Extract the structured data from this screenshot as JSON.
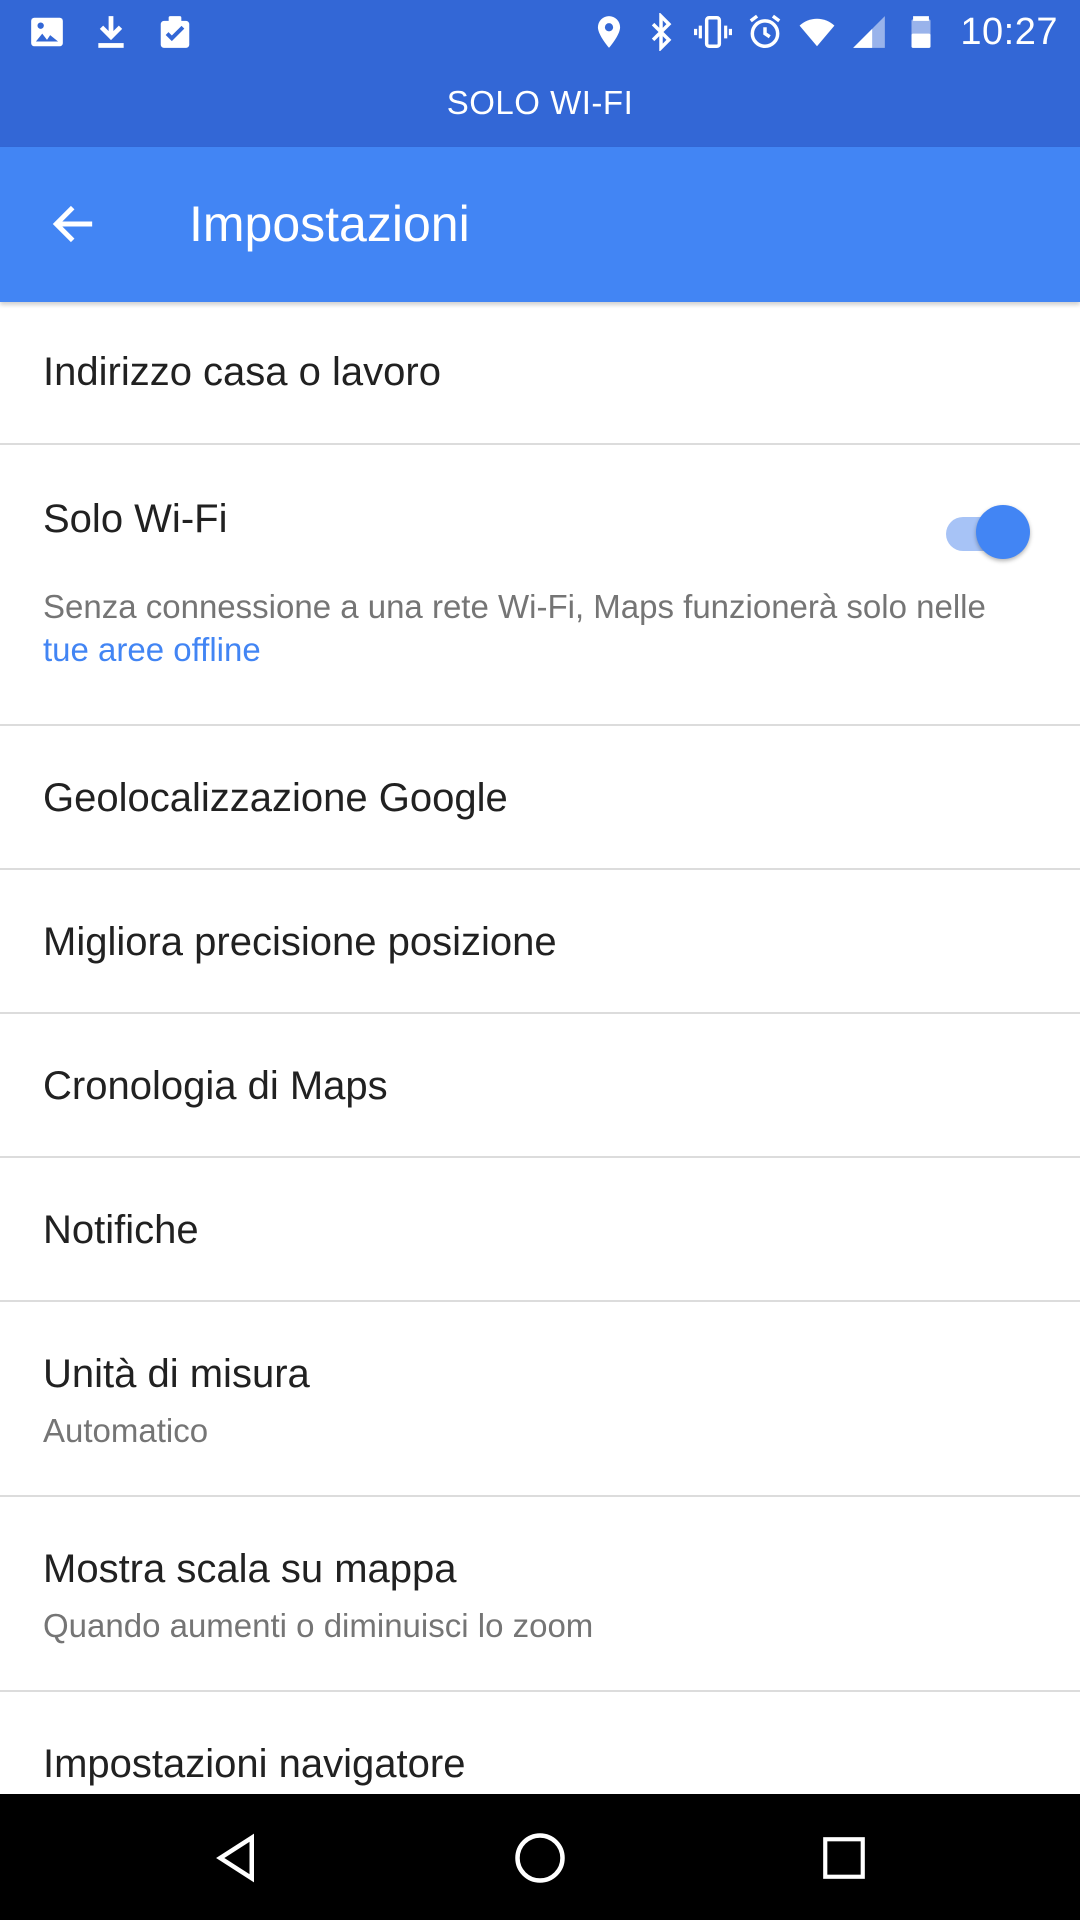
{
  "status_bar": {
    "time": "10:27",
    "left_icons": [
      "image-icon",
      "download-icon",
      "clipboard-check-icon"
    ],
    "right_icons": [
      "location-icon",
      "bluetooth-icon",
      "vibrate-icon",
      "alarm-icon",
      "wifi-icon",
      "signal-icon",
      "battery-icon"
    ]
  },
  "banner": {
    "text": "SOLO WI-FI"
  },
  "app_bar": {
    "title": "Impostazioni",
    "back_icon": "arrow-back-icon"
  },
  "settings": {
    "home_work": {
      "title": "Indirizzo casa o lavoro"
    },
    "wifi_only": {
      "title": "Solo Wi-Fi",
      "toggle_on": true,
      "desc_prefix": "Senza connessione a una rete Wi-Fi, Maps funzionerà solo nelle ",
      "desc_link": "tue aree offline"
    },
    "google_location": {
      "title": "Geolocalizzazione Google"
    },
    "location_accuracy": {
      "title": "Migliora precisione posizione"
    },
    "maps_history": {
      "title": "Cronologia di Maps"
    },
    "notifications": {
      "title": "Notifiche"
    },
    "units": {
      "title": "Unità di misura",
      "subtitle": "Automatico"
    },
    "scale": {
      "title": "Mostra scala su mappa",
      "subtitle": "Quando aumenti o diminuisci lo zoom"
    },
    "navigation": {
      "title": "Impostazioni navigatore"
    }
  },
  "colors": {
    "status_bar": "#3367d6",
    "app_bar": "#4285f4",
    "accent": "#4285f4",
    "divider": "#dcdcdc",
    "nav_bar": "#000000"
  },
  "nav_bar": {
    "buttons": [
      "back-triangle-icon",
      "home-circle-icon",
      "recents-square-icon"
    ]
  }
}
